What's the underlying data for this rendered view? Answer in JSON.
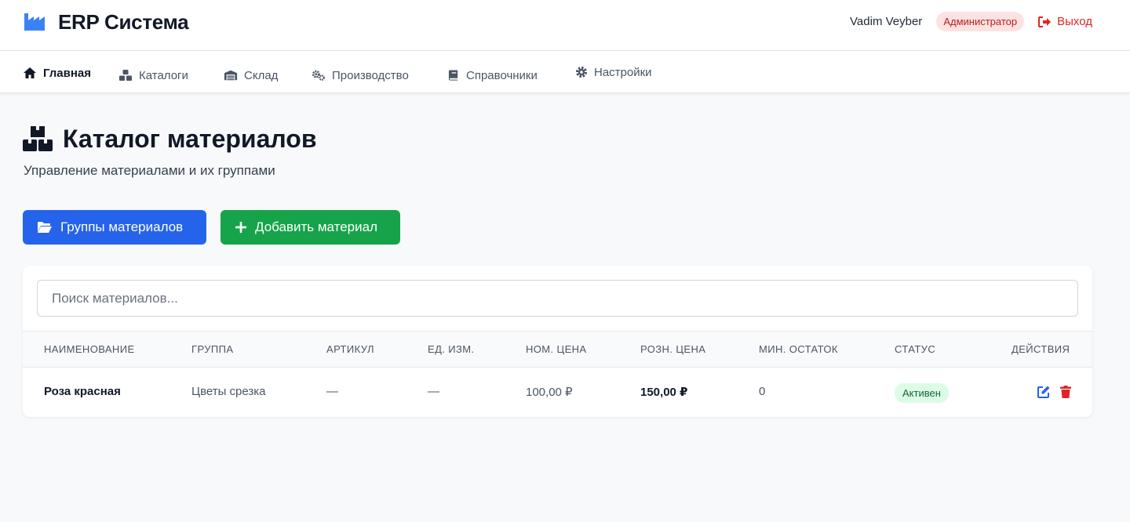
{
  "header": {
    "brand_title": "ERP Система",
    "user_name": "Vadim Veyber",
    "role": "Администратор",
    "logout_label": "Выход"
  },
  "nav": {
    "items": [
      {
        "label": "Главная",
        "icon": "home-icon",
        "active": true
      },
      {
        "label": "Каталоги",
        "icon": "boxes-icon"
      },
      {
        "label": "Склад",
        "icon": "warehouse-icon"
      },
      {
        "label": "Производство",
        "icon": "gears-icon"
      },
      {
        "label": "Справочники",
        "icon": "book-icon"
      },
      {
        "label": "Настройки",
        "icon": "gear-icon"
      }
    ]
  },
  "page": {
    "title": "Каталог материалов",
    "subtitle": "Управление материалами и их группами"
  },
  "buttons": {
    "groups_label": "Группы материалов",
    "add_label": "Добавить материал"
  },
  "search": {
    "placeholder": "Поиск материалов..."
  },
  "table": {
    "headers": [
      "Наименование",
      "Группа",
      "Артикул",
      "Ед. изм.",
      "Ном. цена",
      "Розн. цена",
      "Мин. остаток",
      "Статус",
      "Действия"
    ],
    "rows": [
      {
        "name": "Роза красная",
        "group": "Цветы срезка",
        "sku": "—",
        "unit": "—",
        "nominal_price": "100,00 ₽",
        "retail_price": "150,00 ₽",
        "min_stock": "0",
        "status": "Активен"
      }
    ]
  },
  "colors": {
    "primary": "#2563eb",
    "success": "#16a34a",
    "danger": "#dc2626",
    "brand_icon": "#3b82f6"
  }
}
